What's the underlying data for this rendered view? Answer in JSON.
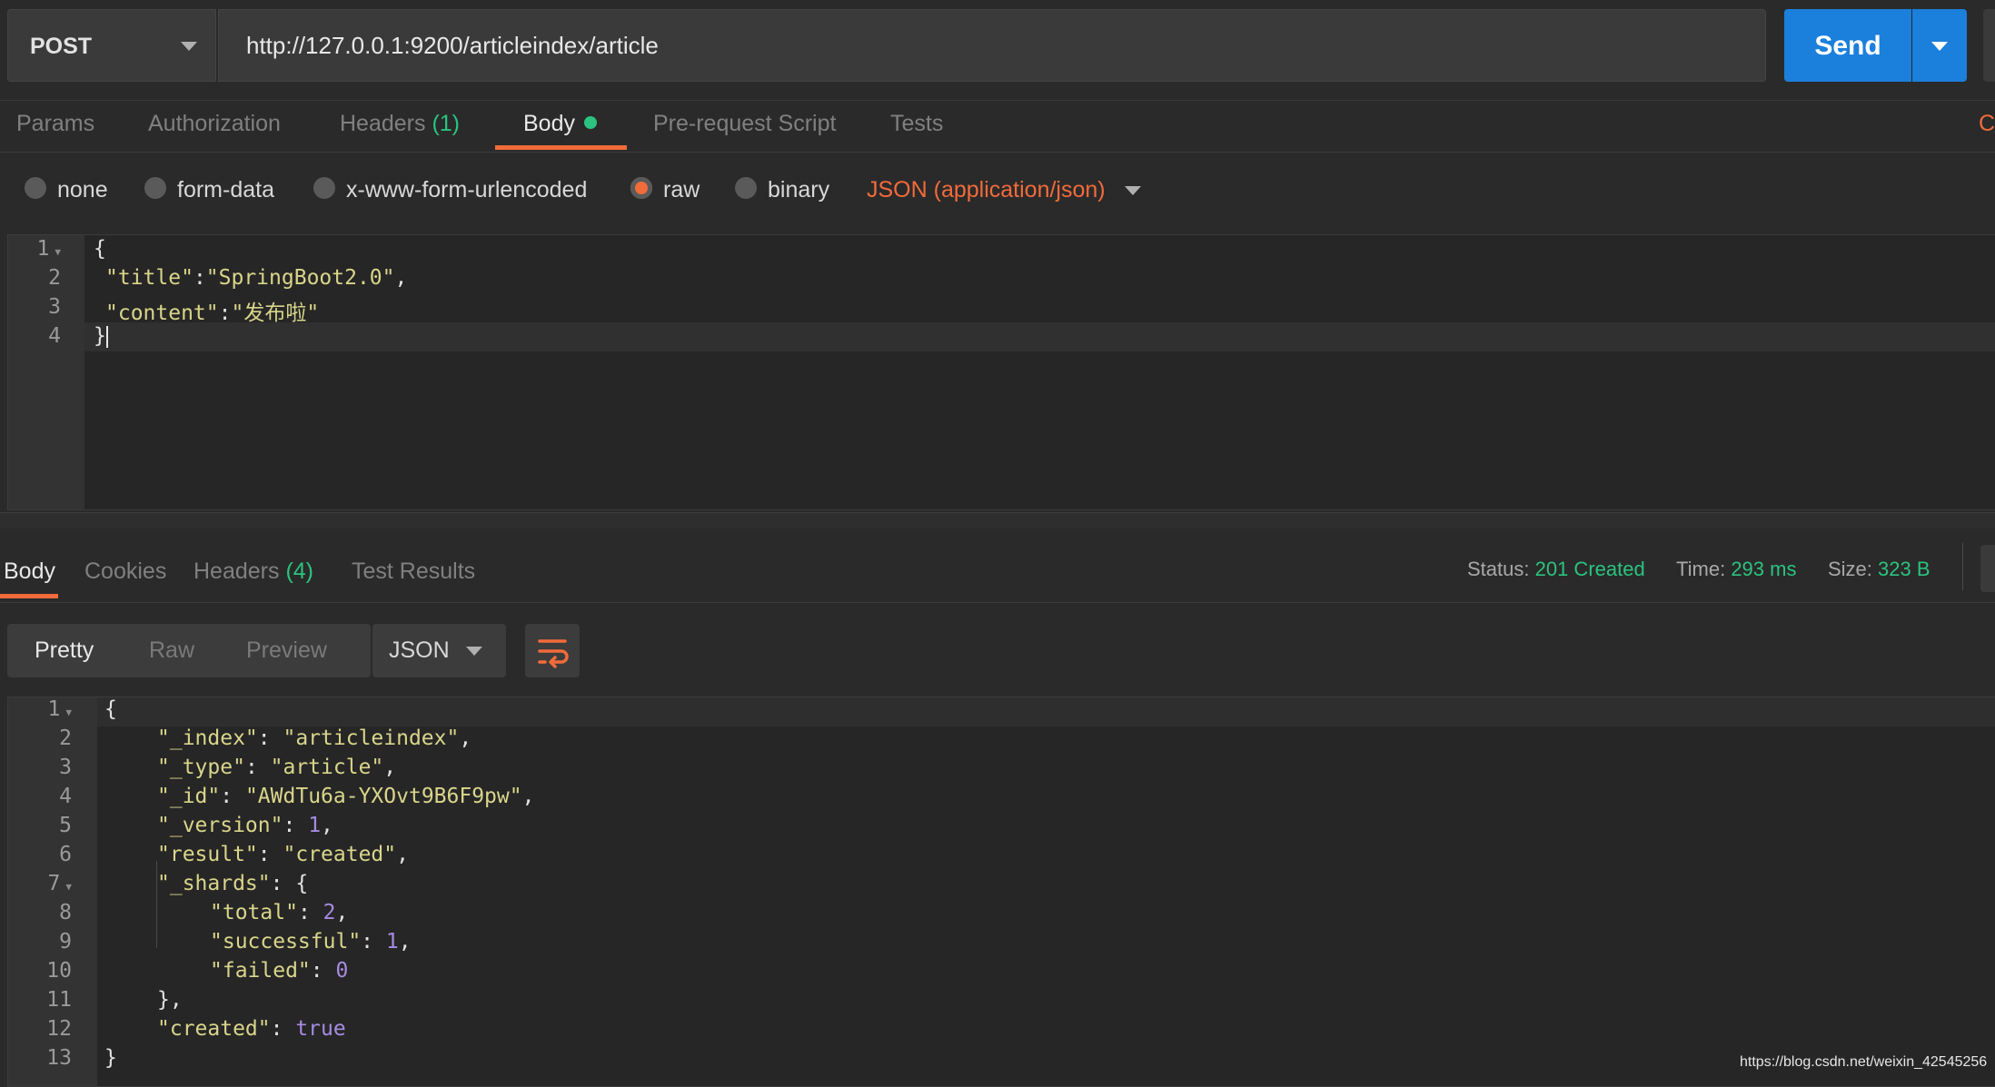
{
  "request": {
    "method": "POST",
    "url": "http://127.0.0.1:9200/articleindex/article",
    "send_label": "Send"
  },
  "request_tabs": {
    "params": "Params",
    "authorization": "Authorization",
    "headers": "Headers",
    "headers_count": "(1)",
    "body": "Body",
    "pre_request": "Pre-request Script",
    "tests": "Tests",
    "cut_off": "C"
  },
  "body_types": {
    "none": "none",
    "form_data": "form-data",
    "urlencoded": "x-www-form-urlencoded",
    "raw": "raw",
    "binary": "binary",
    "selected": "raw",
    "content_type": "JSON (application/json)"
  },
  "request_body": {
    "line_numbers": [
      "1",
      "2",
      "3",
      "4"
    ],
    "open": "{",
    "title_key": "\"title\"",
    "title_value": "\"SpringBoot2.0\"",
    "content_key": "\"content\"",
    "content_value": "\"发布啦\"",
    "close": "}"
  },
  "response_tabs": {
    "body": "Body",
    "cookies": "Cookies",
    "headers": "Headers",
    "headers_count": "(4)",
    "test_results": "Test Results"
  },
  "response_meta": {
    "status_label": "Status:",
    "status_value": "201 Created",
    "time_label": "Time:",
    "time_value": "293 ms",
    "size_label": "Size:",
    "size_value": "323 B"
  },
  "response_toolbar": {
    "pretty": "Pretty",
    "raw": "Raw",
    "preview": "Preview",
    "format": "JSON"
  },
  "response_body": {
    "line_numbers": [
      "1",
      "2",
      "3",
      "4",
      "5",
      "6",
      "7",
      "8",
      "9",
      "10",
      "11",
      "12",
      "13"
    ],
    "index_key": "\"_index\"",
    "index_value": "\"articleindex\"",
    "type_key": "\"_type\"",
    "type_value": "\"article\"",
    "id_key": "\"_id\"",
    "id_value": "\"AWdTu6a-YXOvt9B6F9pw\"",
    "version_key": "\"_version\"",
    "version_value": "1",
    "result_key": "\"result\"",
    "result_value": "\"created\"",
    "shards_key": "\"_shards\"",
    "total_key": "\"total\"",
    "total_value": "2",
    "successful_key": "\"successful\"",
    "successful_value": "1",
    "failed_key": "\"failed\"",
    "failed_value": "0",
    "created_key": "\"created\"",
    "created_value": "true"
  },
  "watermark": "https://blog.csdn.net/weixin_42545256",
  "colors": {
    "accent": "#f26b3a",
    "send": "#1b7fdc",
    "success": "#2bc37f",
    "json_string": "#d9d58b",
    "json_number": "#a58be0"
  }
}
